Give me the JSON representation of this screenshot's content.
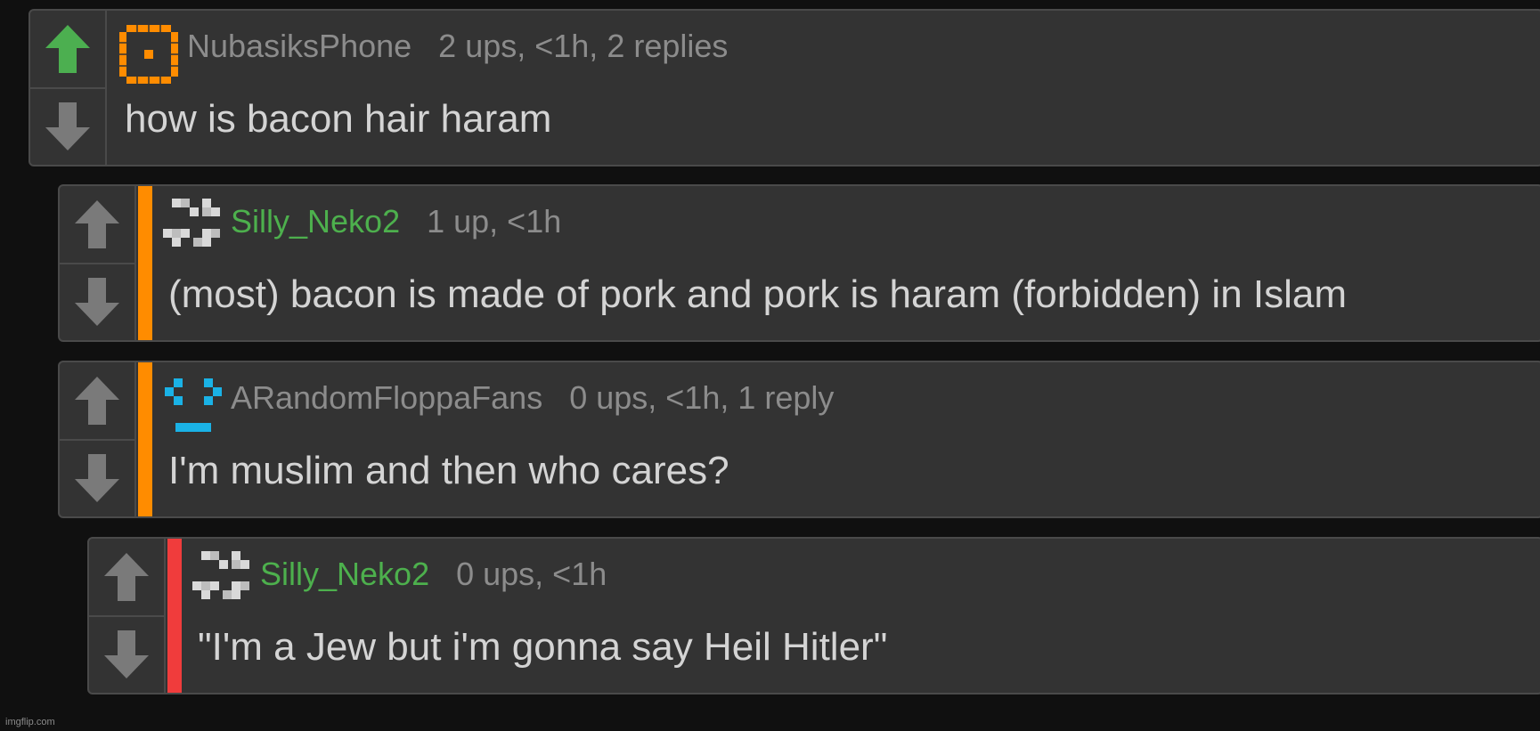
{
  "colors": {
    "upvoted": "#4caf50",
    "vote_default": "#7a7a7a",
    "thread_orange": "#ff8c00",
    "thread_red": "#f03c3c",
    "username_green": "#4db04d"
  },
  "comments": [
    {
      "username": "NubasiksPhone",
      "meta": "2 ups, <1h, 2 replies",
      "text": "how is bacon hair haram",
      "upvoted": true,
      "avatar_icon": "orange-square-avatar-icon"
    },
    {
      "username": "Silly_Neko2",
      "meta": "1 up, <1h",
      "text": "(most) bacon is made of pork and pork is haram (forbidden) in Islam",
      "upvoted": false,
      "avatar_icon": "white-cross-avatar-icon"
    },
    {
      "username": "ARandomFloppaFans",
      "meta": "0 ups, <1h, 1 reply",
      "text": "I'm muslim and then who cares?",
      "upvoted": false,
      "avatar_icon": "blue-face-avatar-icon"
    },
    {
      "username": "Silly_Neko2",
      "meta": "0 ups, <1h",
      "text": "\"I'm a Jew but i'm gonna say Heil Hitler\"",
      "upvoted": false,
      "avatar_icon": "white-cross-avatar-icon"
    }
  ],
  "watermark": "imgflip.com"
}
